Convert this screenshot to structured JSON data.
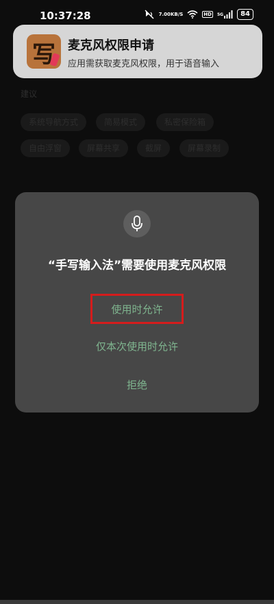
{
  "status_bar": {
    "time": "10:37:28",
    "net_speed_value": "7.00",
    "net_speed_unit": "KB/S",
    "hd_badge": "HD",
    "signal_label": "5G",
    "battery": "84",
    "icons": [
      "mute-icon",
      "wifi-icon",
      "hd-icon",
      "signal-icon",
      "battery-icon"
    ]
  },
  "notification": {
    "icon_glyph": "写",
    "title": "麦克风权限申请",
    "text": "应用需获取麦克风权限，用于语音输入"
  },
  "suggestions": {
    "label": "建议",
    "chips": [
      "系统导航方式",
      "简易模式",
      "私密保险箱",
      "自由浮窗",
      "屏幕共享",
      "截屏",
      "屏幕录制"
    ]
  },
  "dialog": {
    "icon": "microphone-icon",
    "title": "“手写输入法”需要使用麦克风权限",
    "allow_while_using": "使用时允许",
    "allow_once": "仅本次使用时允许",
    "deny": "拒绝"
  },
  "colors": {
    "accent": "#7fb58f",
    "highlight": "#d51c1c",
    "dialog_bg": "#474747"
  }
}
